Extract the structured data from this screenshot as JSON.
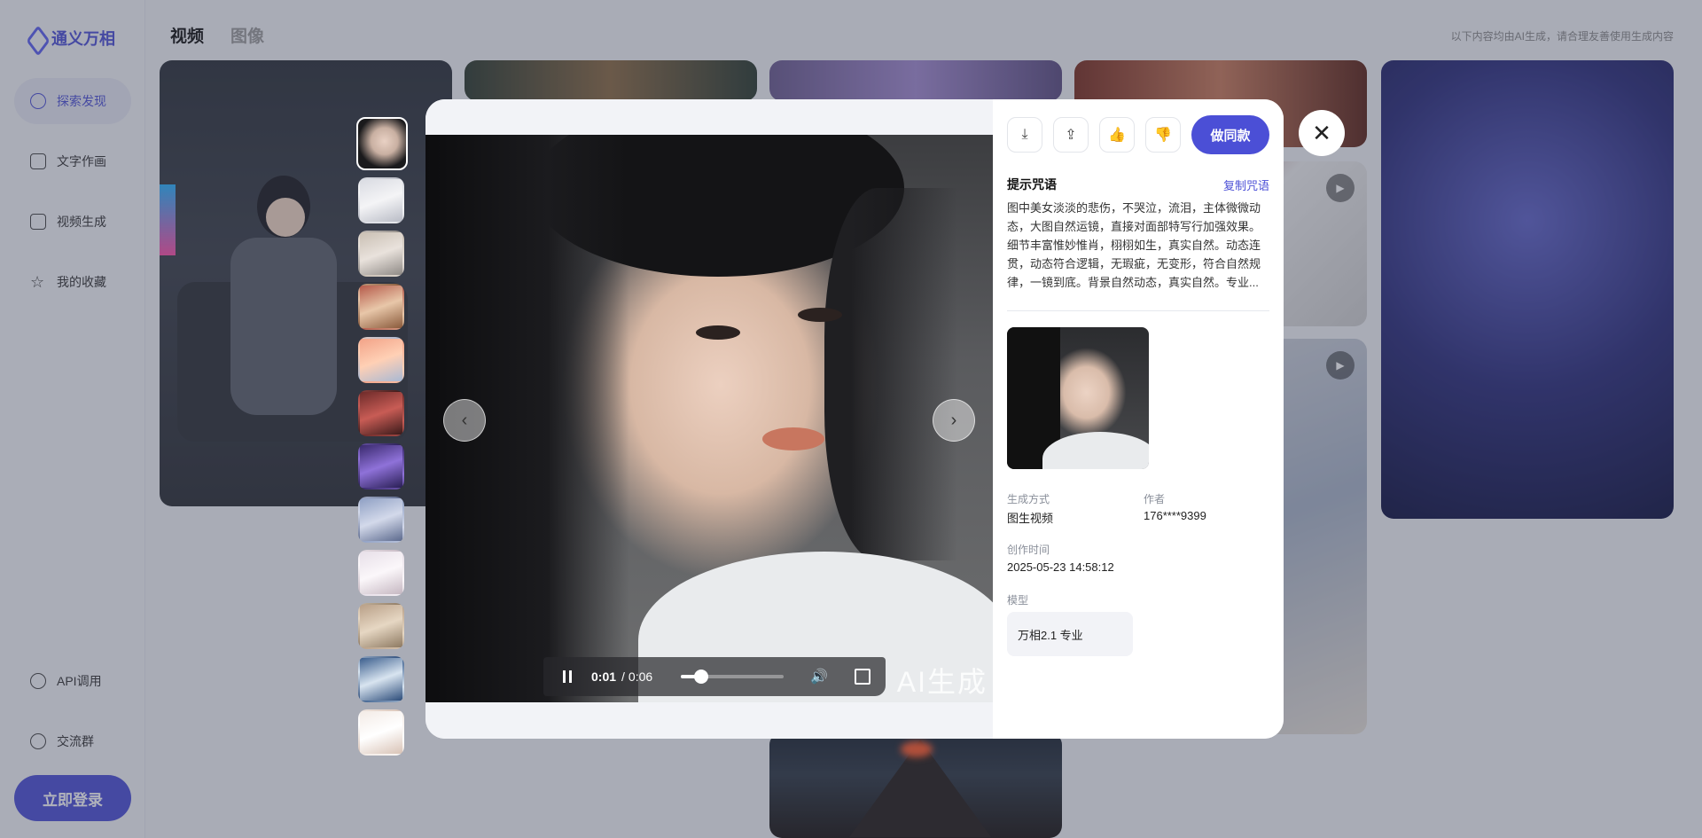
{
  "app": {
    "name": "通义万相"
  },
  "sidebar": {
    "items": [
      {
        "label": "探索发现",
        "icon": "compass-icon",
        "active": true
      },
      {
        "label": "文字作画",
        "icon": "image-edit-icon",
        "active": false
      },
      {
        "label": "视频生成",
        "icon": "video-icon",
        "active": false
      },
      {
        "label": "我的收藏",
        "icon": "star-icon",
        "active": false
      }
    ],
    "bottom_items": [
      {
        "label": "API调用",
        "icon": "cloud-api-icon"
      },
      {
        "label": "交流群",
        "icon": "chat-group-icon"
      }
    ],
    "login_label": "立即登录"
  },
  "header": {
    "tabs": [
      {
        "label": "视频",
        "active": true
      },
      {
        "label": "图像",
        "active": false
      }
    ],
    "notice": "以下内容均由AI生成，请合理友善使用生成内容"
  },
  "player": {
    "current_time": "0:01",
    "separator": "/",
    "total_time": "0:06",
    "progress": 0.2,
    "watermark": "AI生成"
  },
  "detail": {
    "same_style_label": "做同款",
    "prompt_title": "提示咒语",
    "copy_label": "复制咒语",
    "prompt_text": "图中美女淡淡的悲伤，不哭泣，流泪，主体微微动态，大图自然运镜，直接对面部特写行加强效果。细节丰富惟妙惟肖，栩栩如生，真实自然。动态连贯，动态符合逻辑，无瑕疵，无变形，符合自然规律，一镜到底。背景自然动态，真实自然。专业...",
    "gen_method_label": "生成方式",
    "gen_method": "图生视频",
    "author_label": "作者",
    "author": "176****9399",
    "created_label": "创作时间",
    "created": "2025-05-23 14:58:12",
    "model_label": "模型",
    "model": "万相2.1 专业"
  },
  "colors": {
    "accent": "#4b4fd6",
    "overlay": "#3c4254"
  }
}
